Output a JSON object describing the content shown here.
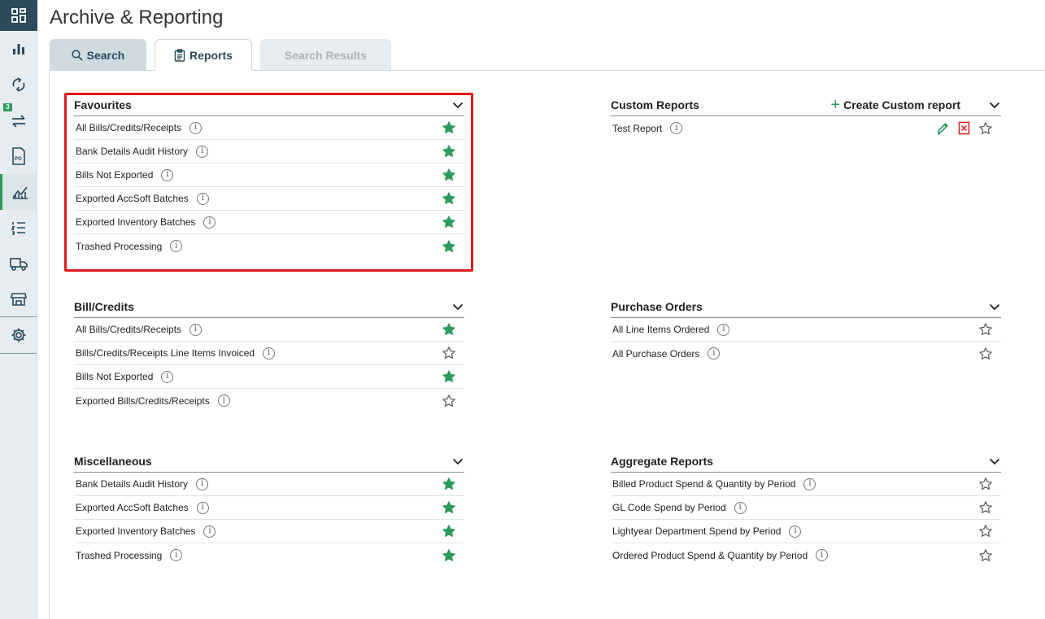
{
  "page": {
    "title": "Archive & Reporting"
  },
  "sidebar": {
    "items": [
      {
        "icon": "dashboard-icon"
      },
      {
        "icon": "bar-chart-icon"
      },
      {
        "icon": "sync-icon"
      },
      {
        "icon": "transfer-icon",
        "badge": "3"
      },
      {
        "icon": "purchase-order-icon",
        "label": "PO"
      },
      {
        "icon": "analytics-icon",
        "active": true
      },
      {
        "icon": "list-icon"
      },
      {
        "icon": "truck-icon"
      },
      {
        "icon": "store-icon"
      },
      {
        "icon": "gear-icon"
      }
    ]
  },
  "tabs": {
    "search": "Search",
    "reports": "Reports",
    "results": "Search Results"
  },
  "favourites": {
    "title": "Favourites",
    "rows": [
      {
        "label": "All Bills/Credits/Receipts",
        "starred": true
      },
      {
        "label": "Bank Details Audit History",
        "starred": true
      },
      {
        "label": "Bills Not Exported",
        "starred": true
      },
      {
        "label": "Exported AccSoft Batches",
        "starred": true
      },
      {
        "label": "Exported Inventory Batches",
        "starred": true
      },
      {
        "label": "Trashed Processing",
        "starred": true
      }
    ]
  },
  "custom_reports": {
    "title": "Custom Reports",
    "create_label": "Create Custom report",
    "rows": [
      {
        "label": "Test Report",
        "starred": false
      }
    ]
  },
  "bill_credits": {
    "title": "Bill/Credits",
    "rows": [
      {
        "label": "All Bills/Credits/Receipts",
        "starred": true
      },
      {
        "label": "Bills/Credits/Receipts Line Items Invoiced",
        "starred": false
      },
      {
        "label": "Bills Not Exported",
        "starred": true
      },
      {
        "label": "Exported Bills/Credits/Receipts",
        "starred": false
      }
    ]
  },
  "purchase_orders": {
    "title": "Purchase Orders",
    "rows": [
      {
        "label": "All Line Items Ordered",
        "starred": false
      },
      {
        "label": "All Purchase Orders",
        "starred": false
      }
    ]
  },
  "miscellaneous": {
    "title": "Miscellaneous",
    "rows": [
      {
        "label": "Bank Details Audit History",
        "starred": true
      },
      {
        "label": "Exported AccSoft Batches",
        "starred": true
      },
      {
        "label": "Exported Inventory Batches",
        "starred": true
      },
      {
        "label": "Trashed Processing",
        "starred": true
      }
    ]
  },
  "aggregate_reports": {
    "title": "Aggregate Reports",
    "rows": [
      {
        "label": "Billed Product Spend & Quantity by Period",
        "starred": false
      },
      {
        "label": "GL Code Spend by Period",
        "starred": false
      },
      {
        "label": "Lightyear Department Spend by Period",
        "starred": false
      },
      {
        "label": "Ordered Product Spend & Quantity by Period",
        "starred": false
      }
    ]
  },
  "colors": {
    "accent": "#2e9b5e",
    "sidebar_dark": "#2b4a5b",
    "highlight": "#e01b1b",
    "delete": "#e01b1b"
  }
}
